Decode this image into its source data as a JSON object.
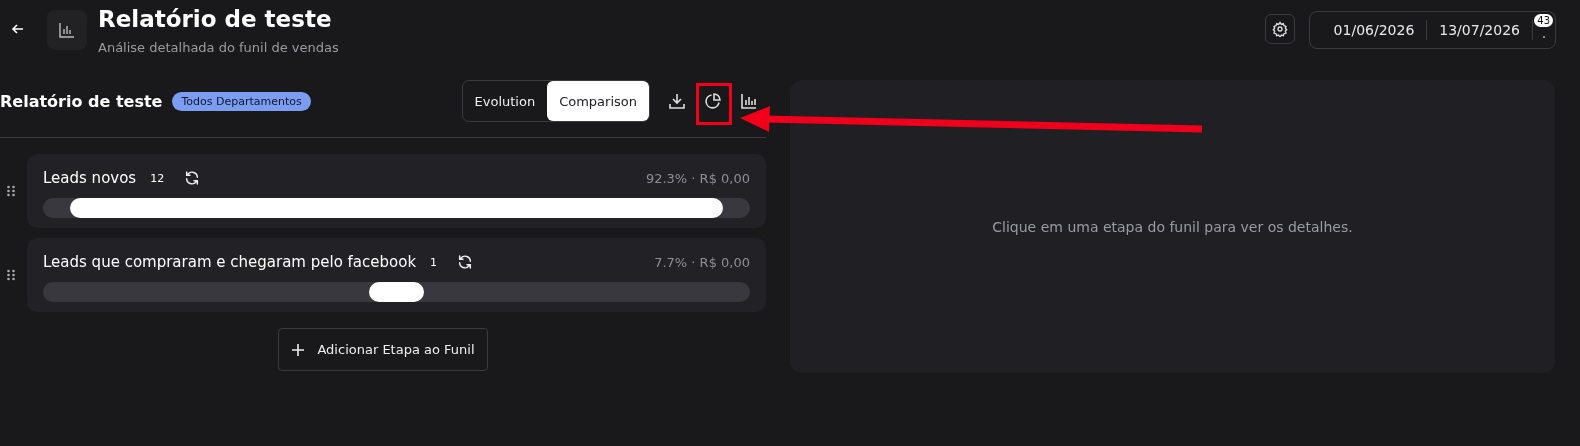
{
  "header": {
    "title": "Relatório de teste",
    "subtitle": "Análise detalhada do funil de vendas",
    "start_date": "01/06/2026",
    "end_date": "13/07/2026",
    "notification_count": "43"
  },
  "funnel": {
    "title": "Relatório de teste",
    "department": "Todos Departamentos",
    "tabs": [
      {
        "label": "Evolution",
        "selected": false
      },
      {
        "label": "Comparison",
        "selected": true
      }
    ],
    "stages": [
      {
        "name": "Leads novos",
        "count": "12",
        "stats": "92.3% · R$ 0,00"
      },
      {
        "name": "Leads que compraram e chegaram pelo facebook",
        "count": "1",
        "stats": "7.7% · R$ 0,00"
      }
    ],
    "add_button": "Adicionar Etapa ao Funil"
  },
  "details": {
    "message": "Clique em uma etapa do funil para ver os detalhes."
  }
}
